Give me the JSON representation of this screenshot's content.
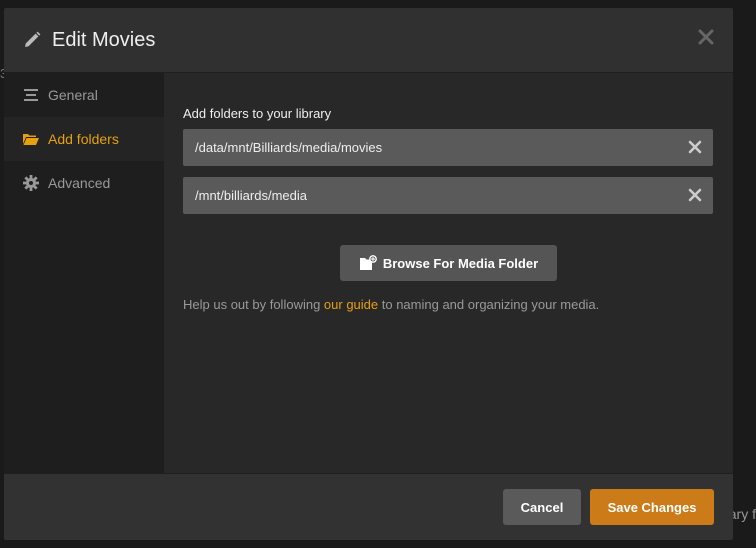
{
  "background": {
    "left_fragment": "3",
    "right_fragment": "ary f"
  },
  "dialog": {
    "title": "Edit Movies"
  },
  "sidebar": {
    "items": [
      {
        "label": "General",
        "icon": "list-icon",
        "active": false
      },
      {
        "label": "Add folders",
        "icon": "folder-open-icon",
        "active": true
      },
      {
        "label": "Advanced",
        "icon": "gear-icon",
        "active": false
      }
    ]
  },
  "main": {
    "section_title": "Add folders to your library",
    "folders": [
      {
        "path": "/data/mnt/Billiards/media/movies"
      },
      {
        "path": "/mnt/billiards/media"
      }
    ],
    "browse_label": "Browse For Media Folder",
    "help_prefix": "Help us out by following ",
    "help_link": "our guide",
    "help_suffix": " to naming and organizing your media."
  },
  "footer": {
    "cancel_label": "Cancel",
    "save_label": "Save Changes"
  },
  "colors": {
    "accent": "#e5a00d",
    "save": "#cc7b19",
    "panel": "#282828",
    "sidebar": "#1e1e1e"
  }
}
